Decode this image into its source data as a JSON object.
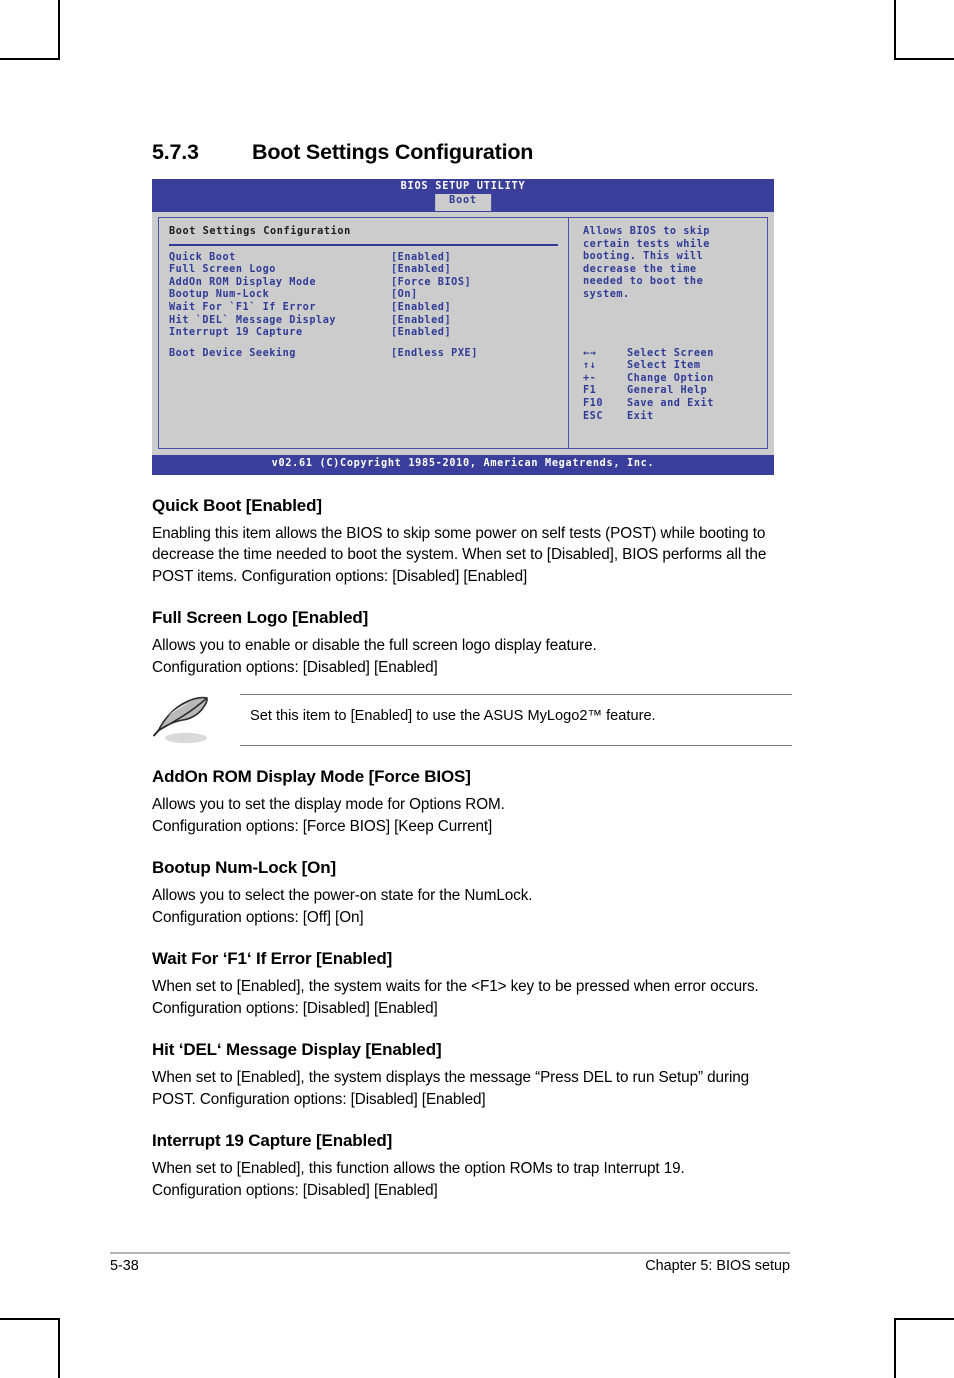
{
  "section": {
    "number": "5.7.3",
    "title": "Boot Settings Configuration"
  },
  "bios": {
    "utility_title": "BIOS SETUP UTILITY",
    "active_tab": "Boot",
    "panel_heading": "Boot Settings Configuration",
    "settings": [
      {
        "name": "Quick Boot",
        "value": "[Enabled]"
      },
      {
        "name": "Full Screen Logo",
        "value": "[Enabled]"
      },
      {
        "name": "AddOn ROM Display Mode",
        "value": "[Force BIOS]"
      },
      {
        "name": "Bootup Num-Lock",
        "value": "[On]"
      },
      {
        "name": "Wait For `F1` If Error",
        "value": "[Enabled]"
      },
      {
        "name": "Hit `DEL` Message Display",
        "value": "[Enabled]"
      },
      {
        "name": "Interrupt 19 Capture",
        "value": "[Enabled]"
      },
      {
        "name": "Boot Device Seeking",
        "value": "[Endless PXE]"
      }
    ],
    "help_text": [
      "Allows BIOS to skip",
      "certain tests while",
      "booting. This will",
      "decrease the time",
      "needed to boot the",
      "system."
    ],
    "key_legend": [
      {
        "key": "←→",
        "action": "Select Screen"
      },
      {
        "key": "↑↓",
        "action": "Select Item"
      },
      {
        "key": "+-",
        "action": "Change Option"
      },
      {
        "key": "F1",
        "action": "General Help"
      },
      {
        "key": "F10",
        "action": "Save and Exit"
      },
      {
        "key": "ESC",
        "action": "Exit"
      }
    ],
    "footer": "v02.61 (C)Copyright 1985-2010, American Megatrends, Inc.",
    "colors": {
      "header_blue": "#3b3f9c",
      "panel_gray": "#cccccc",
      "text_blue": "#2f3b96"
    }
  },
  "items": [
    {
      "heading": "Quick Boot [Enabled]",
      "body": "Enabling this item allows the BIOS to skip some power on self tests (POST) while booting to decrease the time needed to boot the system. When set to [Disabled], BIOS performs all the POST items. Configuration options: [Disabled] [Enabled]"
    },
    {
      "heading": "Full Screen Logo [Enabled]",
      "body": "Allows you to enable or disable the full screen logo display feature.\nConfiguration options: [Disabled] [Enabled]"
    },
    {
      "heading": "AddOn ROM Display Mode [Force BIOS]",
      "body": "Allows you to set the display mode for Options ROM.\nConfiguration options: [Force BIOS] [Keep Current]"
    },
    {
      "heading": "Bootup Num-Lock [On]",
      "body": "Allows you to select the power-on state for the NumLock.\nConfiguration options: [Off] [On]"
    },
    {
      "heading": "Wait For ‘F1‘ If Error [Enabled]",
      "body": "When set to [Enabled], the system waits for the <F1> key to be pressed when error occurs. Configuration options: [Disabled] [Enabled]"
    },
    {
      "heading": "Hit ‘DEL‘ Message Display [Enabled]",
      "body": "When set to [Enabled], the system displays the message “Press DEL to run Setup” during POST. Configuration options: [Disabled] [Enabled]"
    },
    {
      "heading": "Interrupt 19 Capture [Enabled]",
      "body": "When set to [Enabled], this function allows the option ROMs to trap Interrupt 19.\nConfiguration options: [Disabled] [Enabled]"
    }
  ],
  "note": {
    "icon": "quill-pen-icon",
    "text": "Set this item to [Enabled] to use the ASUS MyLogo2™ feature."
  },
  "page_footer": {
    "page_number": "5-38",
    "chapter": "Chapter 5: BIOS setup"
  }
}
